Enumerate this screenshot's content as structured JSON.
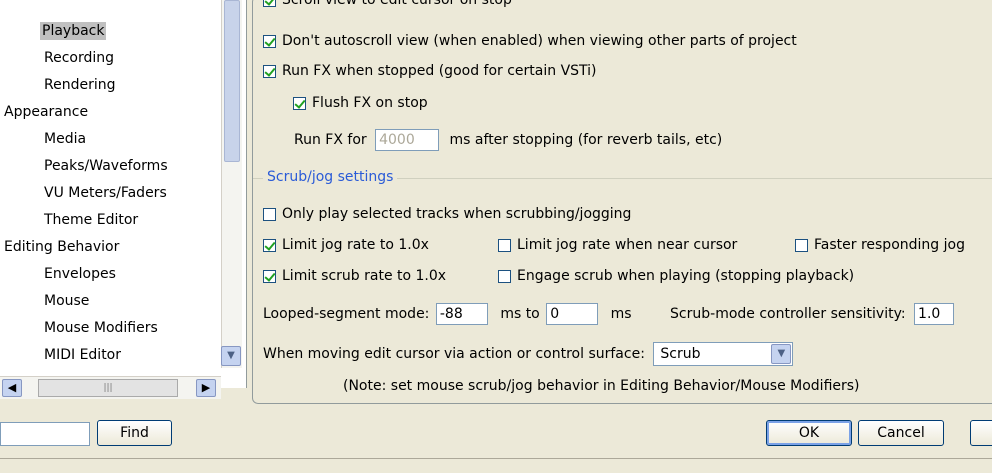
{
  "sidebar": {
    "items": [
      {
        "label": "Playback",
        "selected": true
      },
      {
        "label": "Recording"
      },
      {
        "label": "Rendering"
      },
      {
        "label": "Appearance"
      },
      {
        "label": "Media"
      },
      {
        "label": "Peaks/Waveforms"
      },
      {
        "label": "VU Meters/Faders"
      },
      {
        "label": "Theme Editor"
      },
      {
        "label": "Editing Behavior"
      },
      {
        "label": "Envelopes"
      },
      {
        "label": "Mouse"
      },
      {
        "label": "Mouse Modifiers"
      },
      {
        "label": "MIDI Editor"
      }
    ]
  },
  "settings": {
    "cut_off_label": "Scroll view to edit cursor on stop",
    "dont_autoscroll": "Don't autoscroll view (when enabled) when viewing other parts of project",
    "run_fx_stopped": "Run FX when stopped (good for certain VSTi)",
    "flush_fx": "Flush FX on stop",
    "run_fx_for_label": "Run FX for",
    "run_fx_for_value": "4000",
    "run_fx_for_suffix": "ms after stopping (for reverb tails, etc)"
  },
  "scrub": {
    "group_label": "Scrub/jog settings",
    "only_play_selected": "Only play selected tracks when scrubbing/jogging",
    "limit_jog_rate": "Limit jog rate to 1.0x",
    "limit_jog_near_cursor": "Limit jog rate when near cursor",
    "faster_jog": "Faster responding jog",
    "limit_scrub_rate": "Limit scrub rate to 1.0x",
    "engage_scrub": "Engage scrub when playing (stopping playback)",
    "looped_label": "Looped-segment mode:",
    "looped_from": "-88",
    "looped_to_label": "ms to",
    "looped_to": "0",
    "looped_ms": "ms",
    "sensitivity_label": "Scrub-mode controller sensitivity:",
    "sensitivity_value": "1.0",
    "edit_cursor_label": "When moving edit cursor via action or control surface:",
    "edit_cursor_value": "Scrub",
    "note": "(Note: set mouse scrub/jog behavior in Editing Behavior/Mouse Modifiers)"
  },
  "footer": {
    "find_label": "Find",
    "ok_label": "OK",
    "cancel_label": "Cancel"
  },
  "colors": {
    "accent": "#2a5bd7",
    "check": "#21a121"
  }
}
